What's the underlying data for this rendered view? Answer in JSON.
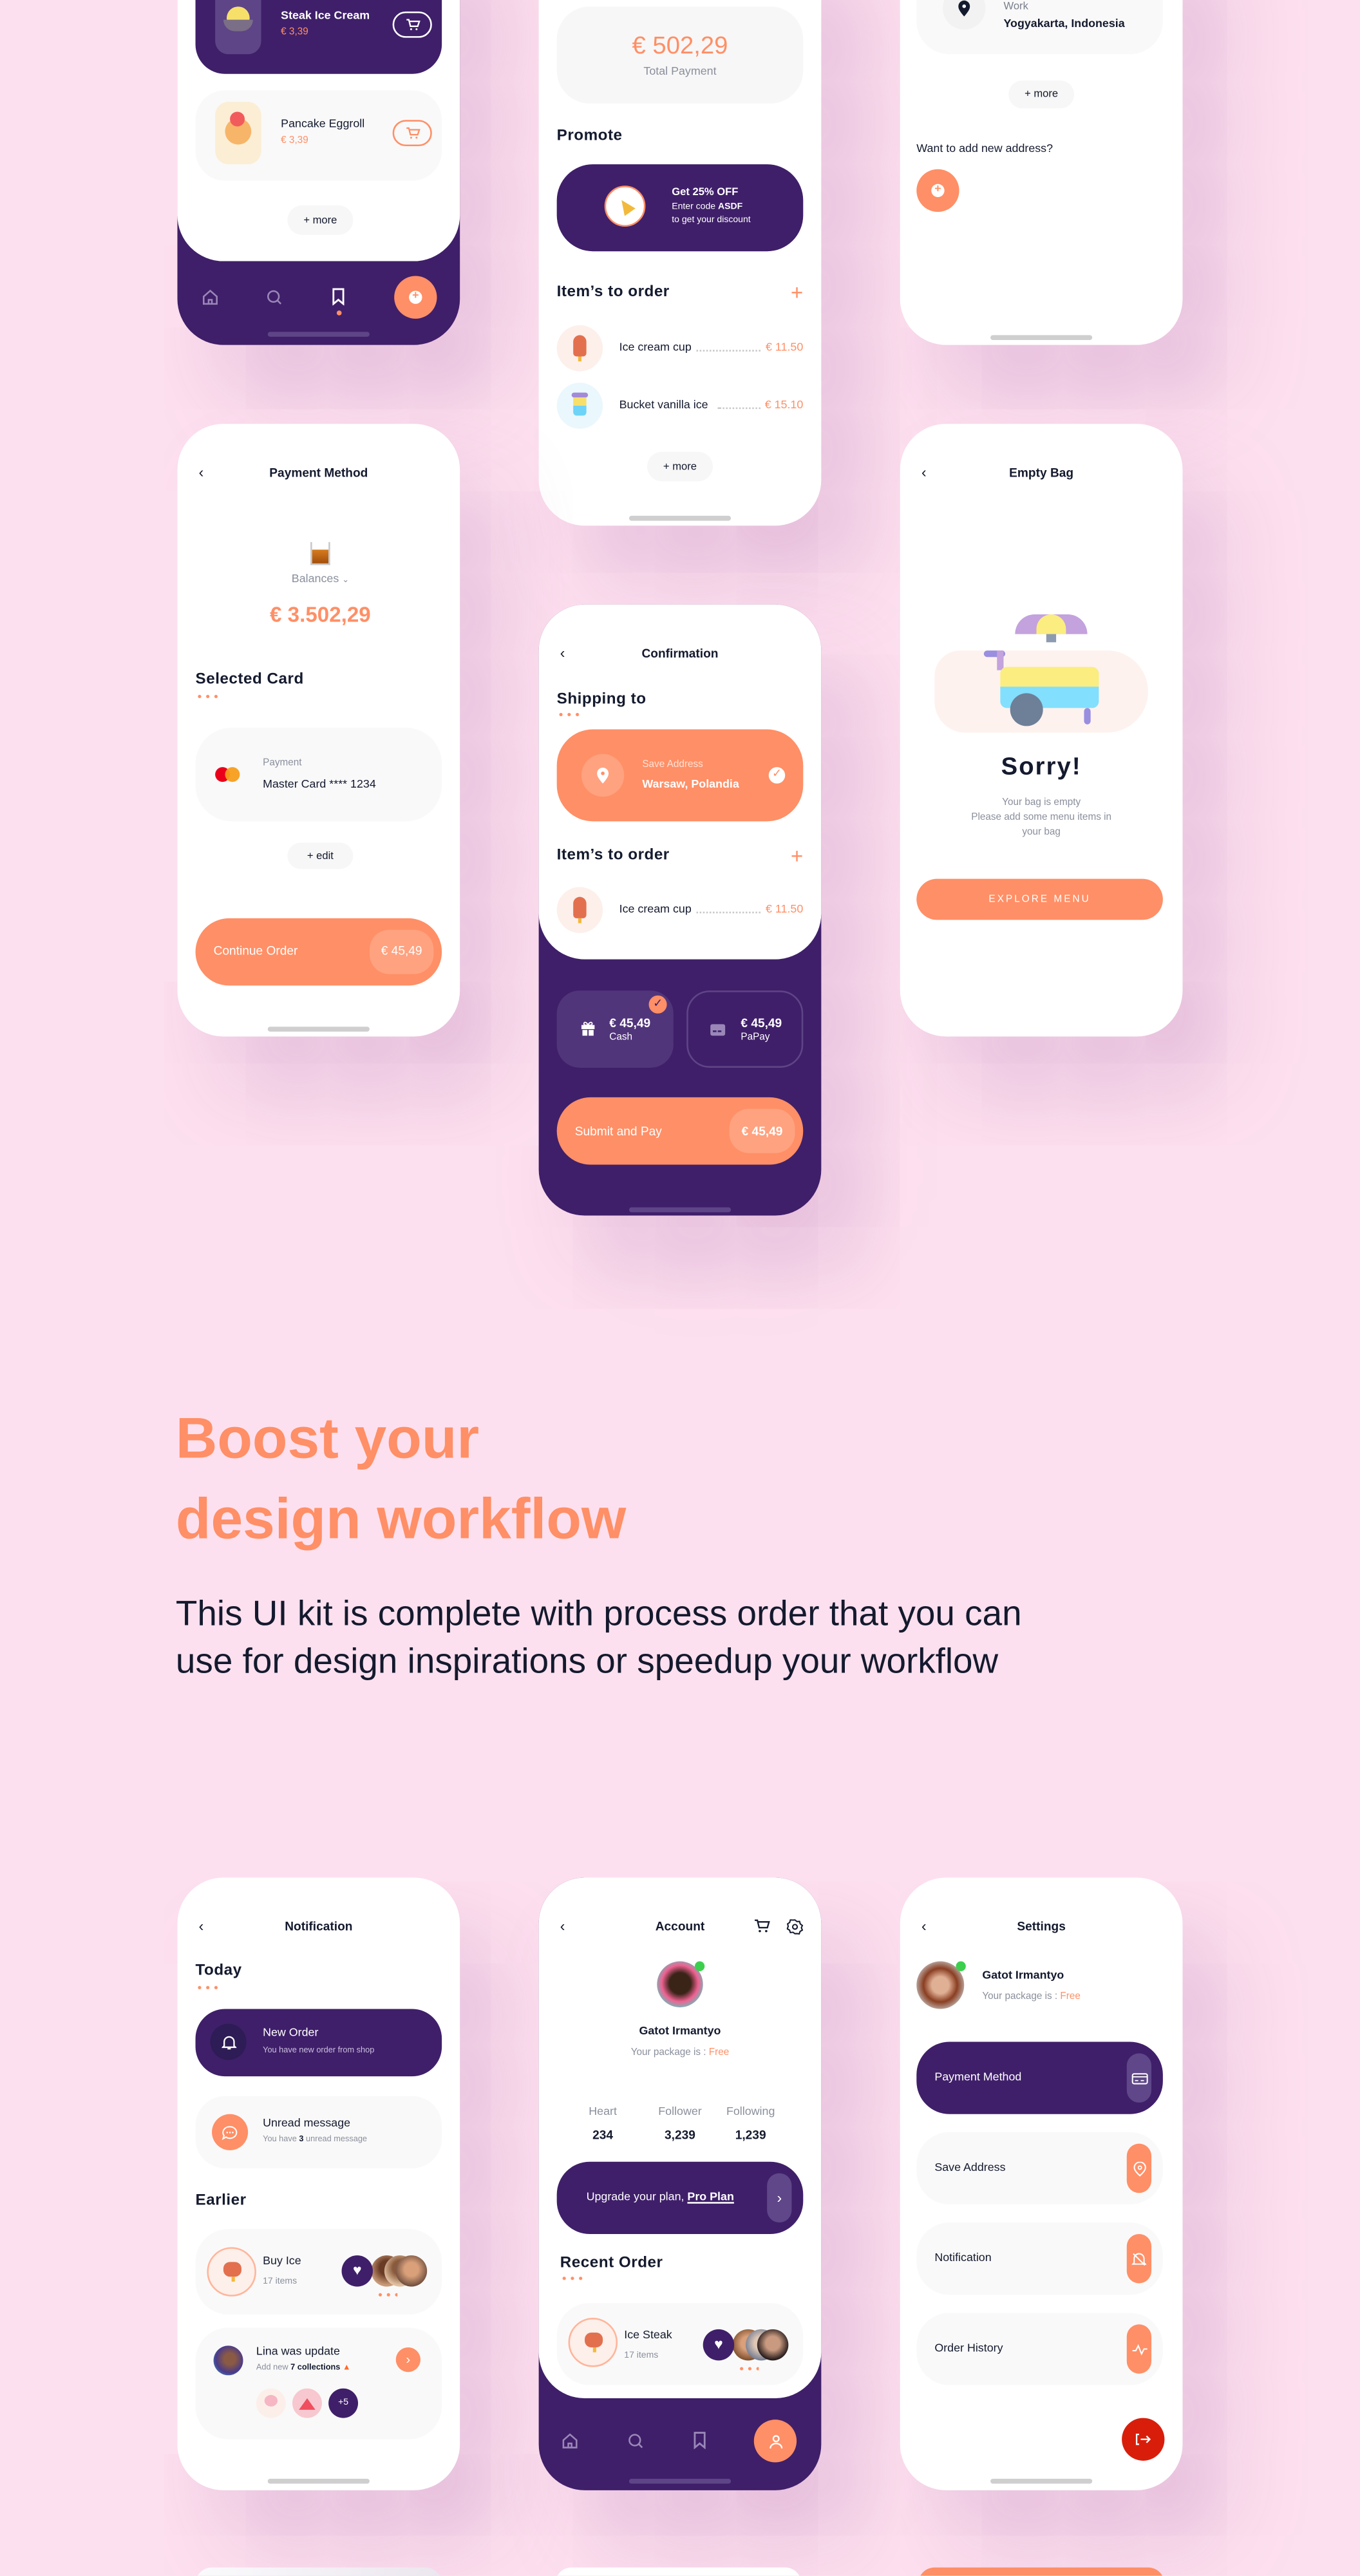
{
  "colors": {
    "background": "#fde0ef",
    "primary_purple": "#3f1f69",
    "accent_orange": "#ff8f66",
    "text_dark": "#141a2e",
    "logout_red": "#d81e0b",
    "online_green": "#3ccf4e"
  },
  "product_list": {
    "items": [
      {
        "name": "Steak Ice Cream",
        "price": "€ 3,39",
        "icon": "ice-cream-bowl-icon"
      },
      {
        "name": "Pancake Eggroll",
        "price": "€ 3,39",
        "icon": "pancake-icon"
      }
    ],
    "more": "+ more",
    "nav": [
      {
        "icon": "home-icon"
      },
      {
        "icon": "search-icon"
      },
      {
        "icon": "bookmark-icon",
        "active": true
      },
      {
        "icon": "add-icon"
      }
    ]
  },
  "order_summary": {
    "total": "€ 502,29",
    "total_label": "Total Payment",
    "promote_title": "Promote",
    "promo": {
      "title": "Get 25% OFF",
      "line2_prefix": "Enter code ",
      "code": "ASDF",
      "line3": "to get your discount",
      "icon": "party-popper-icon"
    },
    "items_title": "Item’s to order",
    "items": [
      {
        "name": "Ice cream cup",
        "price": "€ 11.50"
      },
      {
        "name": "Bucket vanilla ice",
        "price": "€ 15.10"
      }
    ],
    "more": "+ more"
  },
  "address": {
    "label": "Work",
    "value": "Yogyakarta, Indonesia",
    "more": "+ more",
    "prompt": "Want to add new address?"
  },
  "payment_method": {
    "title": "Payment Method",
    "balance_label": "Balances",
    "balance": "€ 3.502,29",
    "selected_title": "Selected Card",
    "card_label": "Payment",
    "card_value": "Master Card **** 1234",
    "edit": "+ edit",
    "continue_label": "Continue Order",
    "amount": "€ 45,49"
  },
  "confirmation": {
    "title": "Confirmation",
    "shipping_title": "Shipping to",
    "address_label": "Save Address",
    "address_value": "Warsaw, Polandia",
    "items_title": "Item’s to order",
    "items": [
      {
        "name": "Ice cream cup",
        "price": "€ 11.50"
      }
    ],
    "methods": [
      {
        "amount": "€ 45,49",
        "label": "Cash",
        "selected": true
      },
      {
        "amount": "€ 45,49",
        "label": "PaPay",
        "selected": false
      }
    ],
    "submit_label": "Submit and Pay",
    "submit_amount": "€ 45,49"
  },
  "empty_bag": {
    "title": "Empty Bag",
    "heading": "Sorry!",
    "line1": "Your bag is empty",
    "line2": "Please add some menu items in",
    "line3": "your bag",
    "button": "EXPLORE MENU"
  },
  "marketing": {
    "headline_1": "Boost your",
    "headline_2": "design workflow",
    "body_1": "This UI kit is complete with process order that you can",
    "body_2": "use for design inspirations or speedup your workflow"
  },
  "notification": {
    "title": "Notification",
    "today": "Today",
    "new_order": {
      "title": "New Order",
      "subtitle": "You have new order from shop"
    },
    "unread": {
      "title": "Unread message",
      "sub_prefix": "You have ",
      "count": "3",
      "sub_suffix": " unread message"
    },
    "earlier": "Earlier",
    "buy_ice": {
      "title": "Buy Ice",
      "subtitle": "17 items"
    },
    "lina": {
      "title": "Lina was update",
      "sub_prefix": "Add new ",
      "sub_bold": "7 collections",
      "extra": "+5"
    }
  },
  "account": {
    "title": "Account",
    "name": "Gatot Irmantyo",
    "package_prefix": "Your package is : ",
    "package": "Free",
    "stats": [
      {
        "label": "Heart",
        "value": "234"
      },
      {
        "label": "Follower",
        "value": "3,239"
      },
      {
        "label": "Following",
        "value": "1,239"
      }
    ],
    "upgrade_prefix": "Upgrade your plan, ",
    "upgrade_link": "Pro Plan",
    "recent_title": "Recent Order",
    "recent": {
      "title": "Ice Steak",
      "subtitle": "17 items"
    }
  },
  "settings": {
    "title": "Settings",
    "name": "Gatot Irmantyo",
    "package_prefix": "Your package is : ",
    "package": "Free",
    "items": [
      {
        "label": "Payment Method",
        "icon": "credit-card-icon"
      },
      {
        "label": "Save Address",
        "icon": "location-pin-icon"
      },
      {
        "label": "Notification",
        "icon": "bell-off-icon"
      },
      {
        "label": "Order History",
        "icon": "activity-icon"
      }
    ]
  }
}
